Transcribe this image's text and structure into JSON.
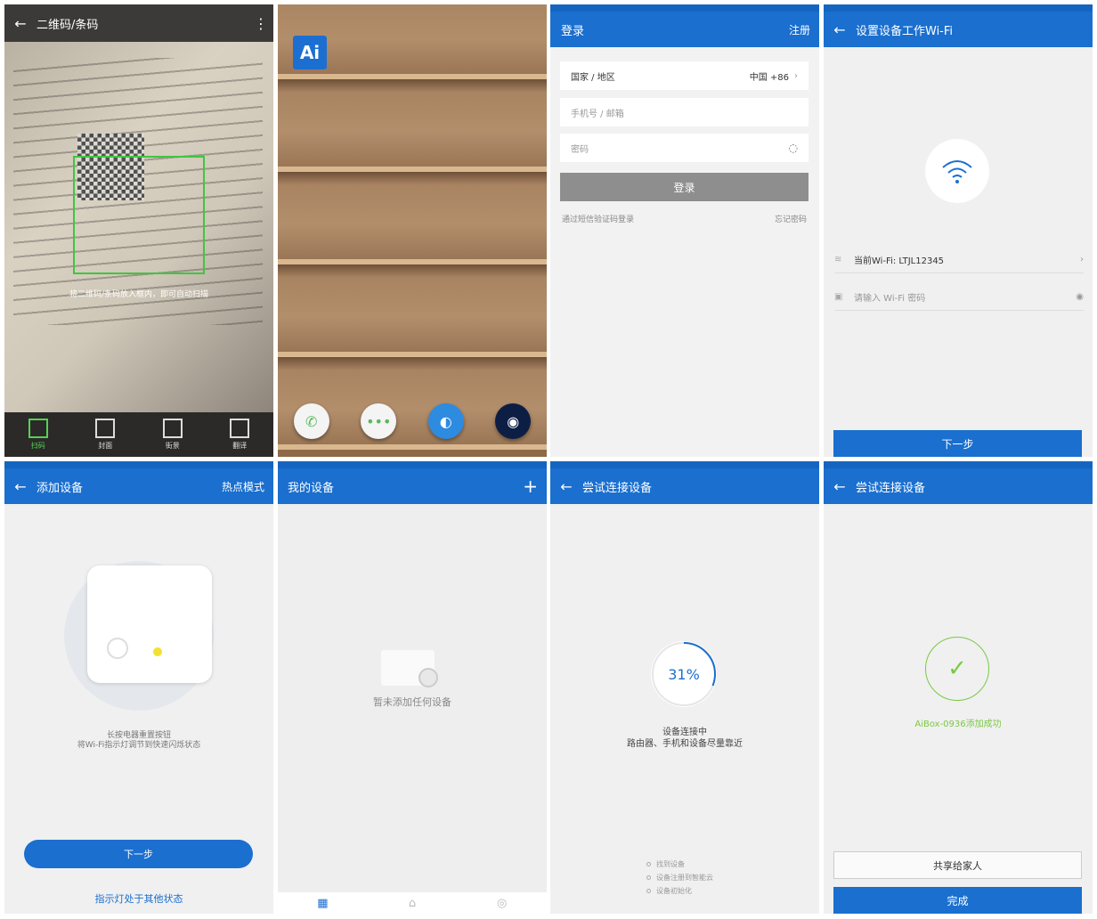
{
  "scanner": {
    "title": "二维码/条码",
    "hint": "将二维码/条码放入框内，即可自动扫描",
    "tools": [
      {
        "label": "扫码",
        "icon": "barcode-icon"
      },
      {
        "label": "封面",
        "icon": "book-icon"
      },
      {
        "label": "街景",
        "icon": "grid-icon"
      },
      {
        "label": "翻译",
        "icon": "translate-icon"
      }
    ]
  },
  "home": {
    "app_logo": "Ai",
    "dock": [
      "phone-icon",
      "messages-icon",
      "browser-icon",
      "camera-icon"
    ]
  },
  "login": {
    "title": "登录",
    "register": "注册",
    "country_label": "国家 / 地区",
    "country_value": "中国 +86",
    "phone_placeholder": "手机号 / 邮箱",
    "password_placeholder": "密码",
    "login_button": "登录",
    "sms_login": "通过短信验证码登录",
    "forgot": "忘记密码"
  },
  "wifi_setup": {
    "title": "设置设备工作Wi-Fi",
    "current_wifi": "当前Wi-Fi: LTJL12345",
    "password_placeholder": "请输入 Wi-Fi 密码",
    "next": "下一步"
  },
  "add_device": {
    "title": "添加设备",
    "hotspot": "热点模式",
    "desc_line1": "长按电器重置按钮",
    "desc_line2": "将Wi-Fi指示灯调节到快速闪烁状态",
    "next": "下一步",
    "other": "指示灯处于其他状态"
  },
  "my_devices": {
    "title": "我的设备",
    "add": "+",
    "empty": "暂未添加任何设备"
  },
  "connecting": {
    "title": "尝试连接设备",
    "percent": "31%",
    "progress": 0.31,
    "status_line1": "设备连接中",
    "status_line2": "路由器、手机和设备尽量靠近",
    "steps": [
      "找到设备",
      "设备注册到智能云",
      "设备初始化"
    ]
  },
  "success": {
    "title": "尝试连接设备",
    "message": "AiBox-0936添加成功",
    "share": "共享给家人",
    "done": "完成"
  },
  "colors": {
    "primary": "#1a6fcf",
    "success": "#7ac943",
    "scan": "#3fc63f"
  }
}
